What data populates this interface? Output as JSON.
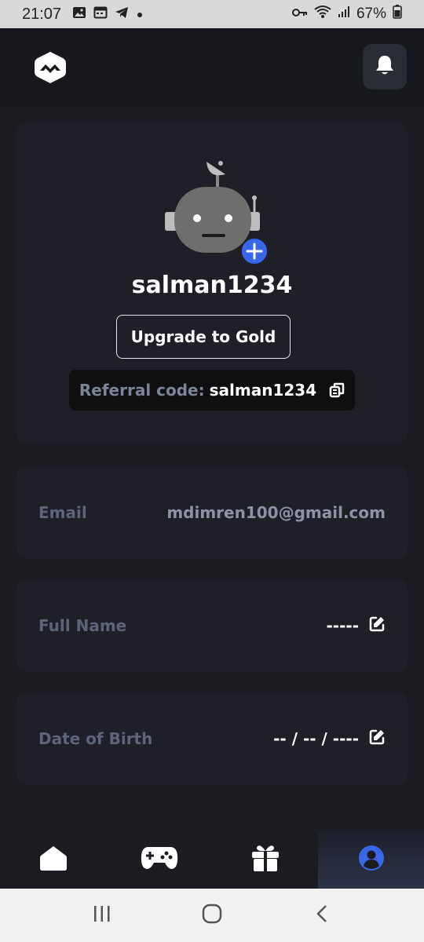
{
  "status_bar": {
    "time": "21:07",
    "battery": "67%",
    "icons": [
      "gallery-icon",
      "calendar-icon",
      "telegram-icon",
      "dot-icon",
      "key-icon",
      "wifi-icon",
      "signal-icon",
      "battery-icon"
    ]
  },
  "header": {
    "logo_icon": "app-logo-icon",
    "bell_icon": "bell-icon"
  },
  "profile": {
    "username": "salman1234",
    "upgrade_label": "Upgrade to Gold",
    "referral_label": "Referral code:",
    "referral_code": "salman1234",
    "avatar_icon": "robot-avatar-icon",
    "add_avatar_icon": "plus-icon"
  },
  "fields": {
    "email": {
      "label": "Email",
      "value": "mdimren100@gmail.com"
    },
    "full_name": {
      "label": "Full Name",
      "value": "-----"
    },
    "dob": {
      "label": "Date of Birth",
      "value": "-- / -- / ----"
    }
  },
  "bottom_nav": {
    "items": [
      {
        "name": "home",
        "icon": "home-icon",
        "active": false
      },
      {
        "name": "games",
        "icon": "gamepad-icon",
        "active": false
      },
      {
        "name": "rewards",
        "icon": "gift-icon",
        "active": false
      },
      {
        "name": "profile",
        "icon": "user-icon",
        "active": true
      }
    ]
  },
  "colors": {
    "background": "#1b1c22",
    "card": "#1f2027",
    "accent": "#3a67e8",
    "muted_label": "#5d6477"
  }
}
